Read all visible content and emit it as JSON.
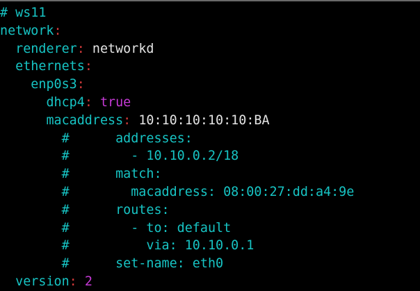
{
  "colors": {
    "background": "#000000",
    "key": "#17c4c4",
    "comment": "#17c4c4",
    "text": "#e4e4e4",
    "colon": "#d43a3a",
    "value_keyword": "#c63ad6"
  },
  "lines": [
    {
      "indent": "",
      "parts": [
        {
          "text": "# ws11",
          "color": "cyan",
          "role": "comment"
        }
      ]
    },
    {
      "indent": "",
      "parts": [
        {
          "text": "network",
          "color": "cyan",
          "role": "key"
        },
        {
          "text": ":",
          "color": "red",
          "role": "colon"
        }
      ]
    },
    {
      "indent": "  ",
      "parts": [
        {
          "text": "renderer",
          "color": "cyan",
          "role": "key"
        },
        {
          "text": ":",
          "color": "red",
          "role": "colon"
        },
        {
          "text": " networkd",
          "color": "white",
          "role": "value"
        }
      ]
    },
    {
      "indent": "  ",
      "parts": [
        {
          "text": "ethernets",
          "color": "cyan",
          "role": "key"
        },
        {
          "text": ":",
          "color": "red",
          "role": "colon"
        }
      ]
    },
    {
      "indent": "    ",
      "parts": [
        {
          "text": "enp0s3",
          "color": "cyan",
          "role": "key"
        },
        {
          "text": ":",
          "color": "red",
          "role": "colon"
        }
      ]
    },
    {
      "indent": "      ",
      "parts": [
        {
          "text": "dhcp4",
          "color": "cyan",
          "role": "key"
        },
        {
          "text": ":",
          "color": "red",
          "role": "colon"
        },
        {
          "text": " true",
          "color": "magenta",
          "role": "value"
        }
      ]
    },
    {
      "indent": "      ",
      "parts": [
        {
          "text": "macaddress",
          "color": "cyan",
          "role": "key"
        },
        {
          "text": ":",
          "color": "red",
          "role": "colon"
        },
        {
          "text": " 10:10:10:10:10:BA",
          "color": "white",
          "role": "value"
        }
      ]
    },
    {
      "indent": "        ",
      "parts": [
        {
          "text": "#      addresses:",
          "color": "cyan",
          "role": "comment"
        }
      ]
    },
    {
      "indent": "        ",
      "parts": [
        {
          "text": "#        - 10.10.0.2/18",
          "color": "cyan",
          "role": "comment"
        }
      ]
    },
    {
      "indent": "        ",
      "parts": [
        {
          "text": "#      match:",
          "color": "cyan",
          "role": "comment"
        }
      ]
    },
    {
      "indent": "        ",
      "parts": [
        {
          "text": "#        macaddress: 08:00:27:dd:a4:9e",
          "color": "cyan",
          "role": "comment"
        }
      ]
    },
    {
      "indent": "        ",
      "parts": [
        {
          "text": "#      routes:",
          "color": "cyan",
          "role": "comment"
        }
      ]
    },
    {
      "indent": "        ",
      "parts": [
        {
          "text": "#        - to: default",
          "color": "cyan",
          "role": "comment"
        }
      ]
    },
    {
      "indent": "        ",
      "parts": [
        {
          "text": "#          via: 10.10.0.1",
          "color": "cyan",
          "role": "comment"
        }
      ]
    },
    {
      "indent": "        ",
      "parts": [
        {
          "text": "#      set-name: eth0",
          "color": "cyan",
          "role": "comment"
        }
      ]
    },
    {
      "indent": "  ",
      "parts": [
        {
          "text": "version",
          "color": "cyan",
          "role": "key"
        },
        {
          "text": ":",
          "color": "red",
          "role": "colon"
        },
        {
          "text": " 2",
          "color": "magenta",
          "role": "value"
        }
      ]
    }
  ]
}
